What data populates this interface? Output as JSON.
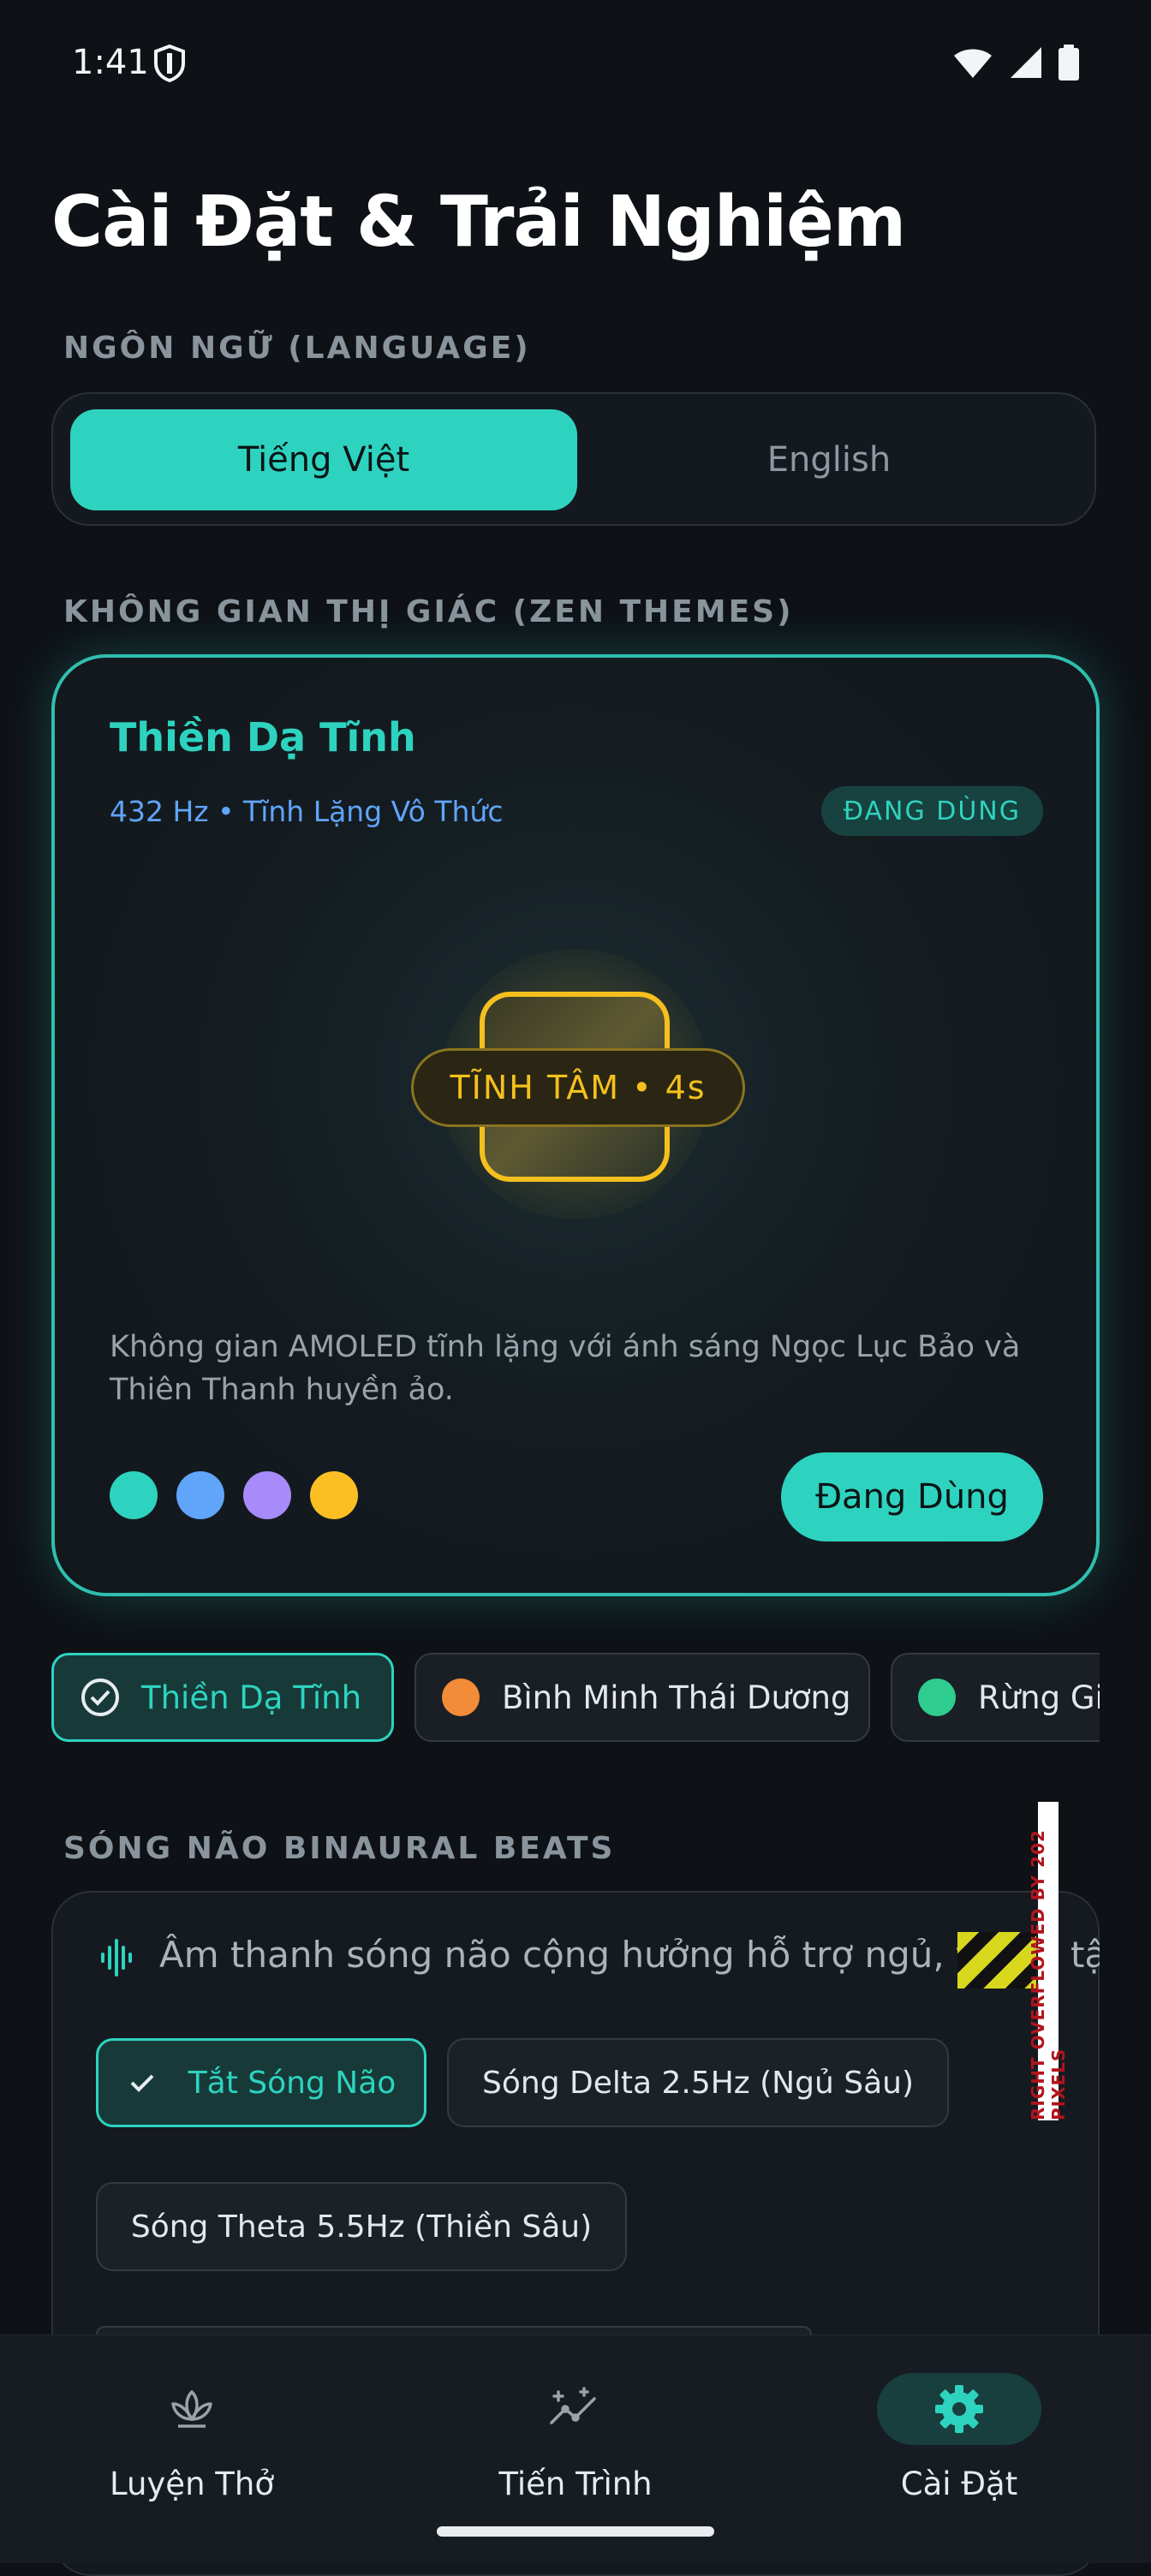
{
  "status": {
    "time": "1:41"
  },
  "title": "Cài Đặt & Trải Nghiệm",
  "language": {
    "section_label": "NGÔN NGỮ (LANGUAGE)",
    "options": [
      "Tiếng Việt",
      "English"
    ],
    "selected": "Tiếng Việt"
  },
  "themes": {
    "section_label": "KHÔNG GIAN THỊ GIÁC (ZEN THEMES)",
    "card": {
      "name": "Thiền Dạ Tĩnh",
      "subtitle": "432 Hz • Tĩnh Lặng Vô Thức",
      "badge": "ĐANG DÙNG",
      "breath_label": "TĨNH TÂM • 4s",
      "description": "Không gian AMOLED tĩnh lặng với ánh sáng Ngọc Lục Bảo và Thiên Thanh huyền ảo.",
      "palette": [
        "#2ed3bf",
        "#60a5fa",
        "#a78bfa",
        "#fbbf24"
      ],
      "button": "Đang Dùng"
    },
    "chips": [
      {
        "label": "Thiền Dạ Tĩnh",
        "color": "#2ed3bf",
        "active": true
      },
      {
        "label": "Bình Minh Thái Dương",
        "color": "#f28c38",
        "active": false
      },
      {
        "label": "Rừng Già",
        "color": "#2ecc8f",
        "active": false
      }
    ]
  },
  "binaural": {
    "section_label": "SÓNG NÃO BINAURAL BEATS",
    "description": "Âm thanh sóng não cộng hưởng hỗ trợ ngủ, thiền, tập trung",
    "options": [
      "Tắt Sóng Não",
      "Sóng Delta 2.5Hz (Ngủ Sâu)",
      "Sóng Theta 5.5Hz (Thiền Sâu)"
    ],
    "selected": "Tắt Sóng Não"
  },
  "debug_overflow": "RIGHT OVERFLOWED BY 202 PIXELS",
  "nav": {
    "items": [
      "Luyện Thở",
      "Tiến Trình",
      "Cài Đặt"
    ],
    "active": "Cài Đặt"
  },
  "accent": "#2ed3bf"
}
